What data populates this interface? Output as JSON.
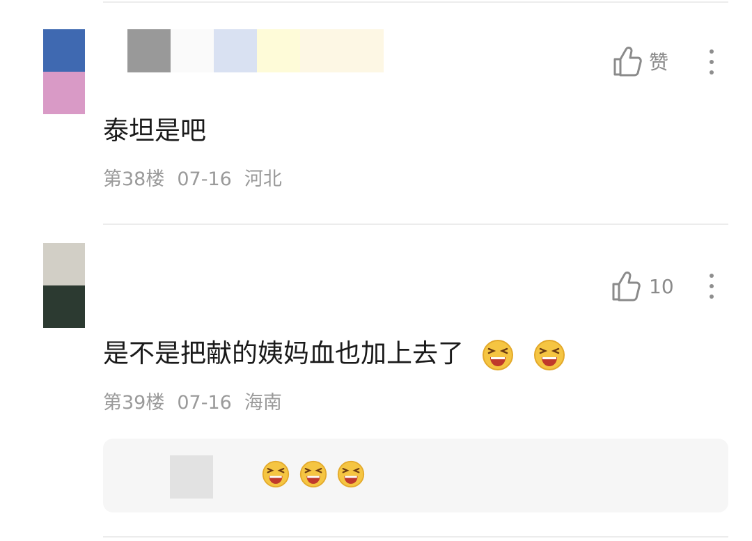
{
  "comments": [
    {
      "text": "泰坦是吧",
      "floor": "第38楼",
      "date": "07-16",
      "location": "河北",
      "like_label": "赞",
      "avatar_colors": [
        "#3f69b1",
        "#d99ac6"
      ]
    },
    {
      "text": "是不是把献的姨妈血也加上去了",
      "floor": "第39楼",
      "date": "07-16",
      "location": "海南",
      "like_label": "10",
      "avatar_colors": [
        "#d2cfc6",
        "#2c3a31"
      ],
      "emojis": [
        "laughing-emoji",
        "laughing-emoji"
      ]
    }
  ],
  "reply_preview": {
    "emojis": [
      "laughing-emoji",
      "laughing-emoji",
      "laughing-emoji"
    ]
  },
  "colors": {
    "text": "#1a1a1a",
    "meta": "#9a9a9a",
    "icon": "#8a8a8a",
    "emoji_face": "#f5c542"
  }
}
